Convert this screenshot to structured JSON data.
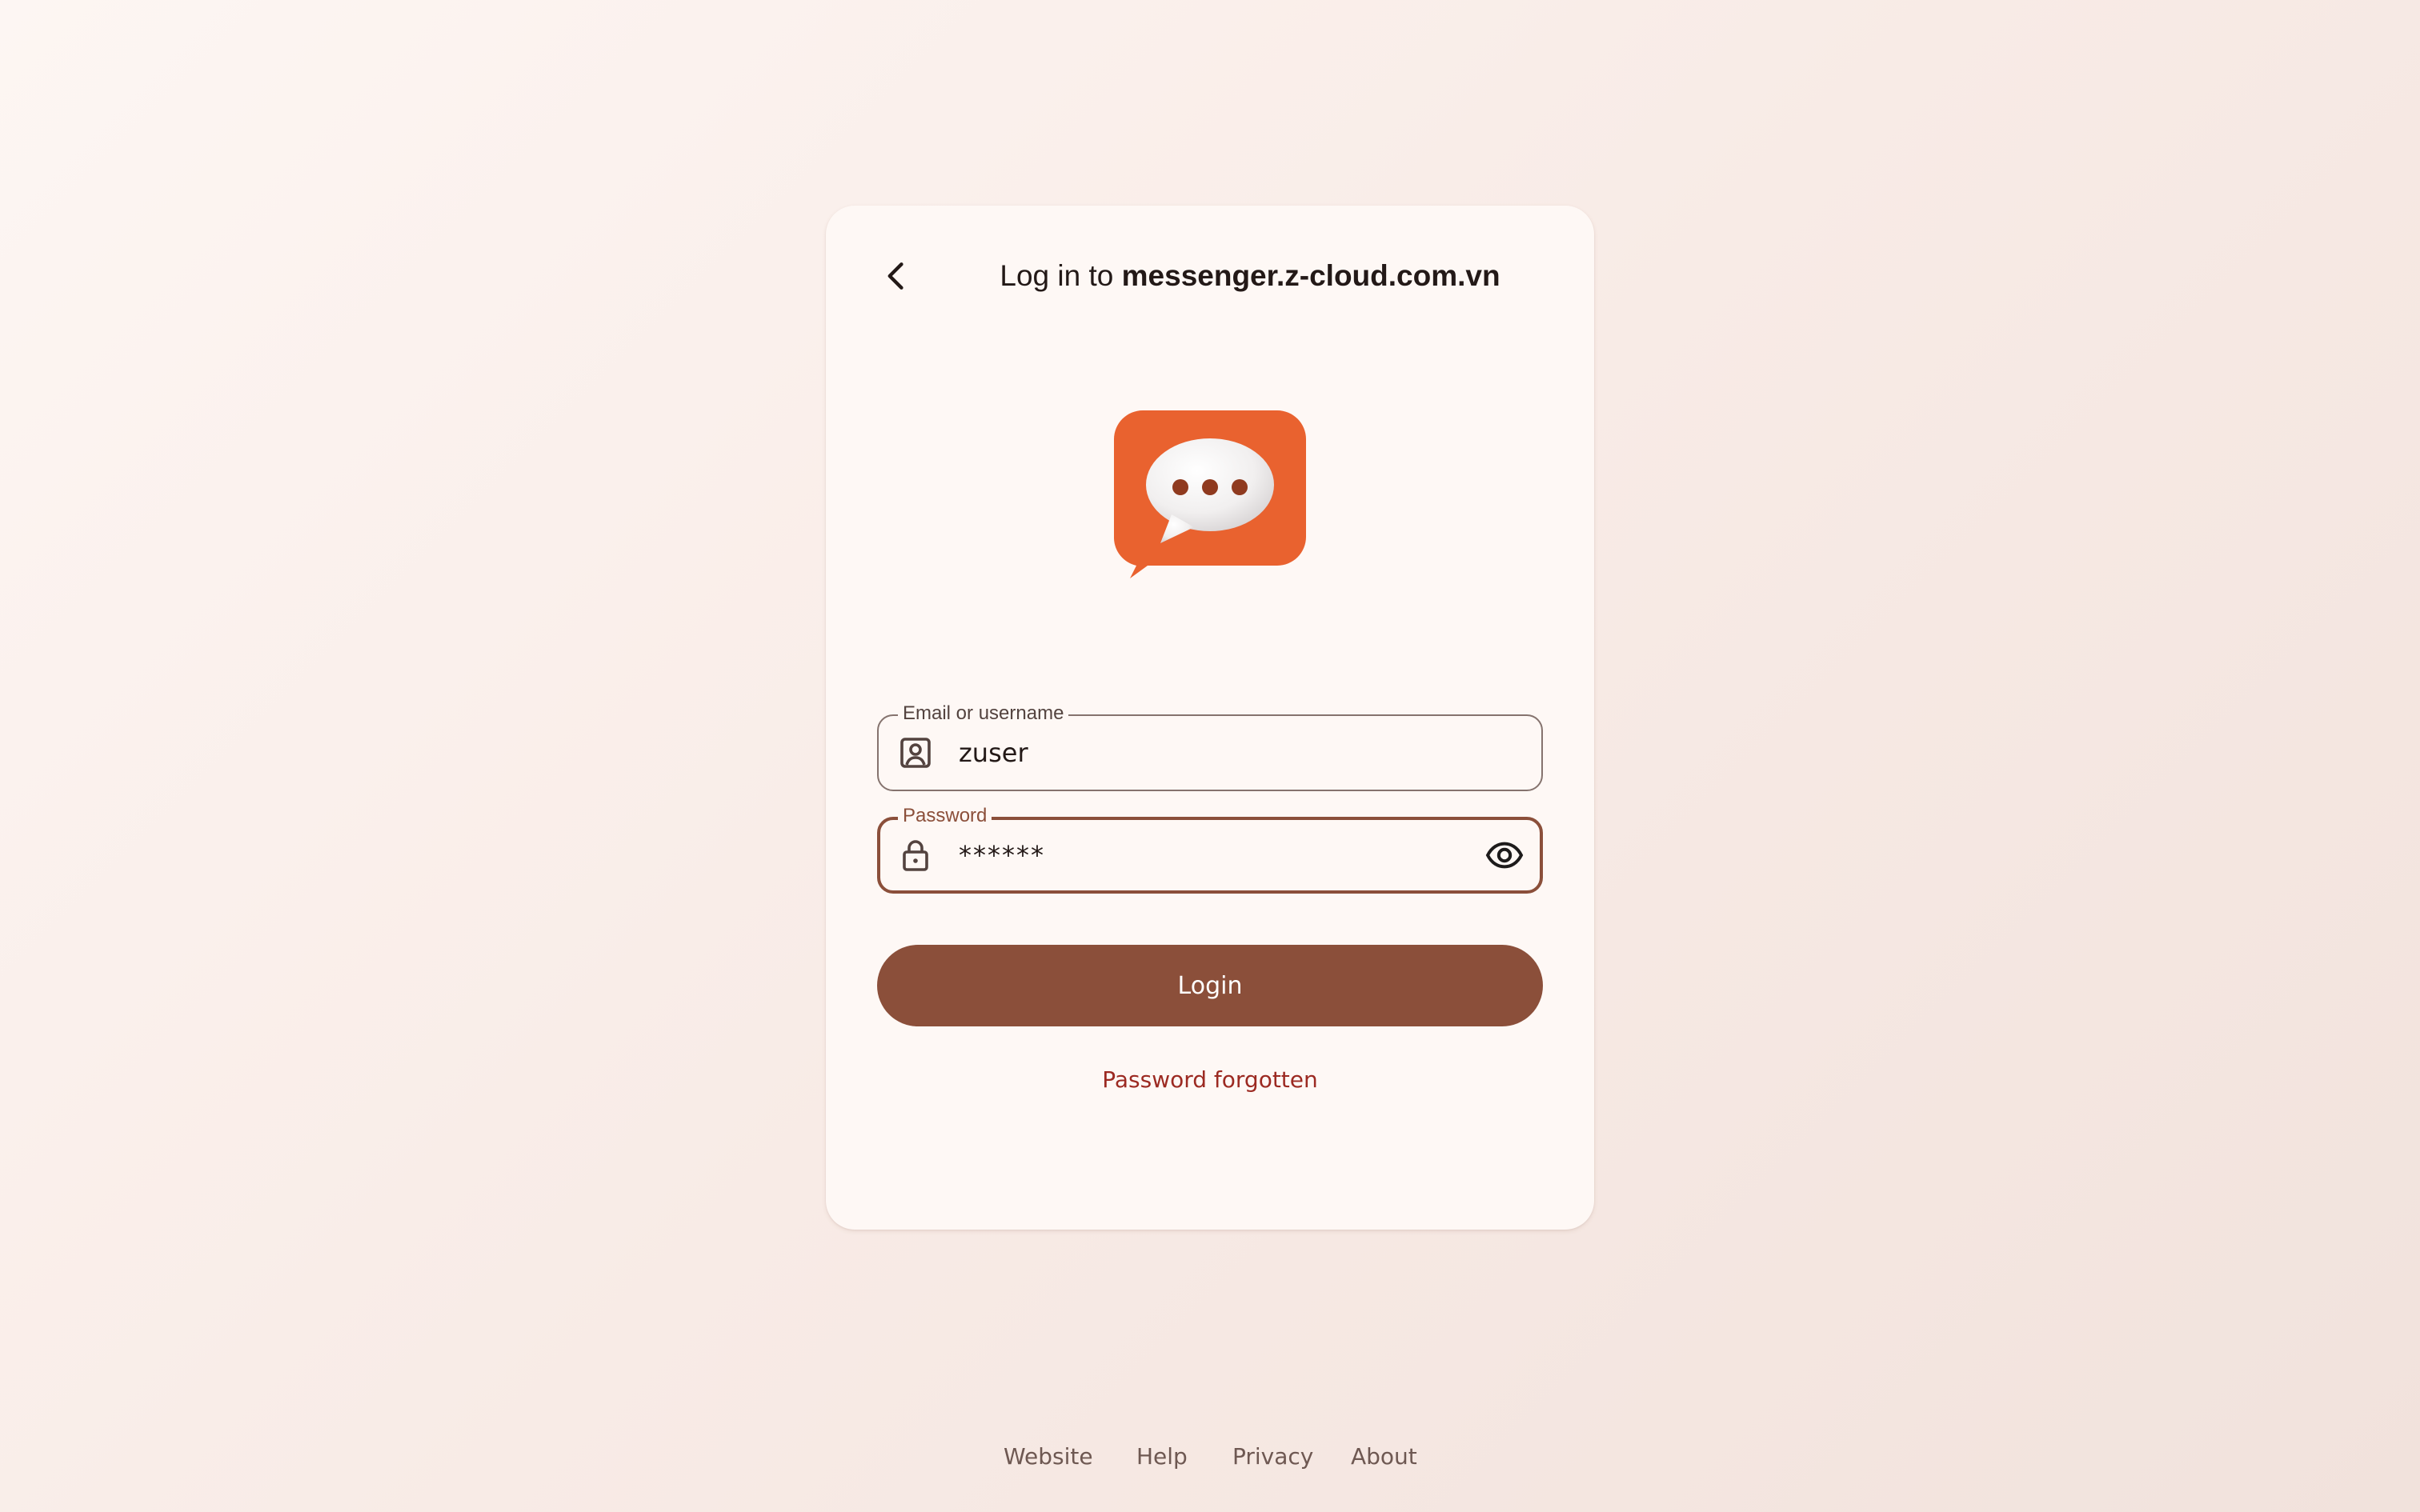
{
  "header": {
    "title_prefix": "Log in to ",
    "title_host": "messenger.z-cloud.com.vn"
  },
  "logo": {
    "icon": "chat-bubble-logo",
    "colors": {
      "primary": "#e9622f",
      "dots": "#8f3a1f"
    }
  },
  "form": {
    "email": {
      "label": "Email or username",
      "value": "zuser",
      "icon": "contact-icon"
    },
    "password": {
      "label": "Password",
      "value": "******",
      "icon": "lock-icon",
      "toggle_icon": "eye-icon"
    },
    "login_label": "Login",
    "forgot_label": "Password forgotten"
  },
  "footer": {
    "links": [
      "Website",
      "Help",
      "Privacy",
      "About"
    ]
  },
  "colors": {
    "accent": "#8b4f3a",
    "link": "#9c2a22",
    "card": "#fef8f5"
  }
}
